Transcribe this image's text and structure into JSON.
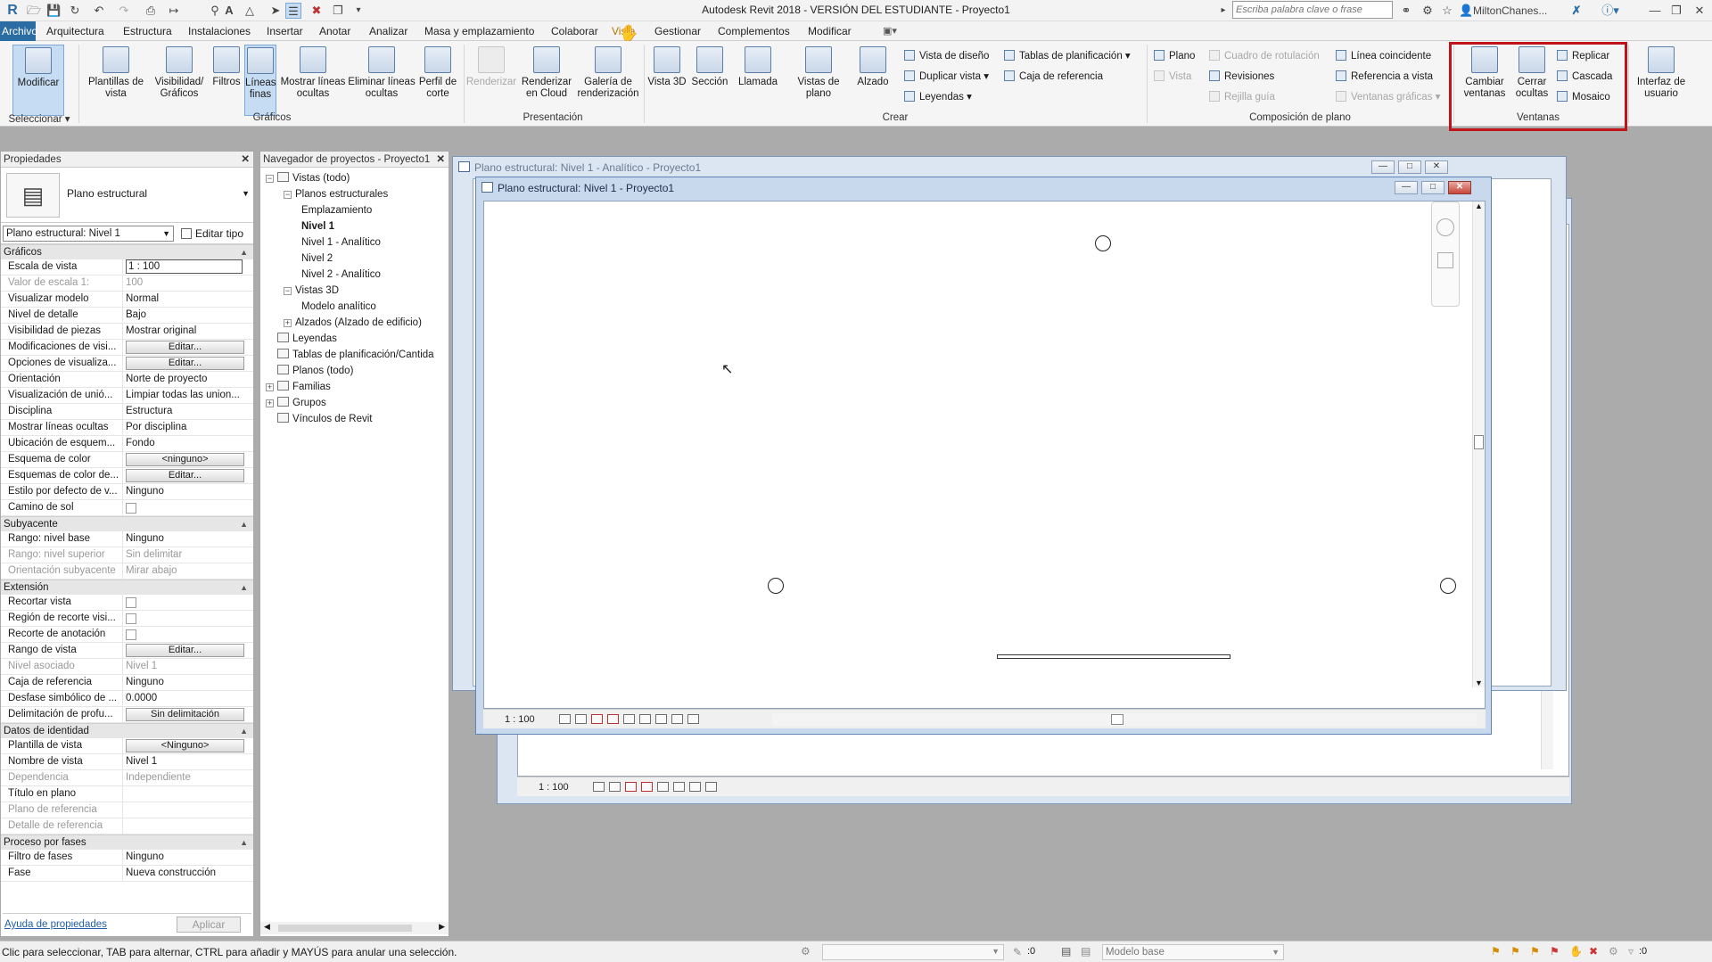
{
  "window": {
    "title": "Autodesk Revit 2018 - VERSIÓN DEL ESTUDIANTE -    Proyecto1",
    "search_placeholder": "Escriba palabra clave o frase",
    "user": "MiltonChanes..."
  },
  "menu": {
    "tabs": [
      "Archivo",
      "Arquitectura",
      "Estructura",
      "Instalaciones",
      "Insertar",
      "Anotar",
      "Analizar",
      "Masa y emplazamiento",
      "Colaborar",
      "Vista",
      "Gestionar",
      "Complementos",
      "Modificar"
    ]
  },
  "ribbon": {
    "select": {
      "modify": "Modificar",
      "select_label": "Seleccionar"
    },
    "graphics": {
      "label": "Gráficos",
      "items": [
        "Plantillas de vista",
        "Visibilidad/ Gráficos",
        "Filtros",
        "Líneas finas",
        "Mostrar líneas ocultas",
        "Eliminar líneas ocultas",
        "Perfil de corte"
      ]
    },
    "presentation": {
      "label": "Presentación",
      "items": [
        "Renderizar",
        "Renderizar en Cloud",
        "Galería de renderización"
      ]
    },
    "create": {
      "label": "Crear",
      "items": [
        "Vista 3D",
        "Sección",
        "Llamada",
        "Vistas de plano",
        "Alzado"
      ],
      "small": [
        "Vista de diseño",
        "Duplicar vista",
        "Leyendas",
        "Tablas de planificación",
        "Caja de referencia"
      ]
    },
    "sheet": {
      "label": "Composición de plano",
      "small": [
        "Plano",
        "Vista",
        "Cuadro de rotulación",
        "Revisiones",
        "Rejilla guía",
        "Línea coincidente",
        "Referencia a vista",
        "Ventanas gráficas"
      ]
    },
    "windows": {
      "label": "Ventanas",
      "items": [
        "Cambiar ventanas",
        "Cerrar ocultas"
      ],
      "small": [
        "Replicar",
        "Cascada",
        "Mosaico"
      ]
    },
    "ui": {
      "label": "Interfaz de usuario"
    }
  },
  "properties": {
    "title": "Propiedades",
    "type_name": "Plano estructural",
    "selector": "Plano estructural: Nivel 1",
    "edit_type": "Editar tipo",
    "sections": [
      {
        "name": "Gráficos",
        "rows": [
          {
            "k": "Escala de vista",
            "v": "1 : 100",
            "t": "input"
          },
          {
            "k": "Valor de escala    1:",
            "v": "100",
            "t": "dis"
          },
          {
            "k": "Visualizar modelo",
            "v": "Normal"
          },
          {
            "k": "Nivel de detalle",
            "v": "Bajo"
          },
          {
            "k": "Visibilidad de piezas",
            "v": "Mostrar original"
          },
          {
            "k": "Modificaciones de visi...",
            "v": "Editar...",
            "t": "btn"
          },
          {
            "k": "Opciones de visualiza...",
            "v": "Editar...",
            "t": "btn"
          },
          {
            "k": "Orientación",
            "v": "Norte de proyecto"
          },
          {
            "k": "Visualización de unió...",
            "v": "Limpiar todas las union..."
          },
          {
            "k": "Disciplina",
            "v": "Estructura"
          },
          {
            "k": "Mostrar líneas ocultas",
            "v": "Por disciplina"
          },
          {
            "k": "Ubicación de esquem...",
            "v": "Fondo"
          },
          {
            "k": "Esquema de color",
            "v": "<ninguno>",
            "t": "btn"
          },
          {
            "k": "Esquemas de color de...",
            "v": "Editar...",
            "t": "btn"
          },
          {
            "k": "Estilo por defecto de v...",
            "v": "Ninguno"
          },
          {
            "k": "Camino de sol",
            "v": "",
            "t": "chk"
          }
        ]
      },
      {
        "name": "Subyacente",
        "rows": [
          {
            "k": "Rango: nivel base",
            "v": "Ninguno"
          },
          {
            "k": "Rango: nivel superior",
            "v": "Sin delimitar",
            "t": "dis"
          },
          {
            "k": "Orientación subyacente",
            "v": "Mirar abajo",
            "t": "dis"
          }
        ]
      },
      {
        "name": "Extensión",
        "rows": [
          {
            "k": "Recortar vista",
            "v": "",
            "t": "chk"
          },
          {
            "k": "Región de recorte visi...",
            "v": "",
            "t": "chk"
          },
          {
            "k": "Recorte de anotación",
            "v": "",
            "t": "chk"
          },
          {
            "k": "Rango de vista",
            "v": "Editar...",
            "t": "btn"
          },
          {
            "k": "Nivel asociado",
            "v": "Nivel 1",
            "t": "dis"
          },
          {
            "k": "Caja de referencia",
            "v": "Ninguno"
          },
          {
            "k": "Desfase simbólico de ...",
            "v": "0.0000"
          },
          {
            "k": "Delimitación de profu...",
            "v": "Sin delimitación",
            "t": "btn"
          }
        ]
      },
      {
        "name": "Datos de identidad",
        "rows": [
          {
            "k": "Plantilla de vista",
            "v": "<Ninguno>",
            "t": "btn"
          },
          {
            "k": "Nombre de vista",
            "v": "Nivel 1"
          },
          {
            "k": "Dependencia",
            "v": "Independiente",
            "t": "dis"
          },
          {
            "k": "Título en plano",
            "v": ""
          },
          {
            "k": "Plano de referencia",
            "v": "",
            "t": "dis"
          },
          {
            "k": "Detalle de referencia",
            "v": "",
            "t": "dis"
          }
        ]
      },
      {
        "name": "Proceso por fases",
        "rows": [
          {
            "k": "Filtro de fases",
            "v": "Ninguno"
          },
          {
            "k": "Fase",
            "v": "Nueva construcción"
          }
        ]
      }
    ],
    "help": "Ayuda de propiedades",
    "apply": "Aplicar"
  },
  "browser": {
    "title": "Navegador de proyectos - Proyecto1",
    "items": [
      {
        "l": "Vistas (todo)",
        "d": 0,
        "tg": "-",
        "ic": true
      },
      {
        "l": "Planos estructurales",
        "d": 1,
        "tg": "-"
      },
      {
        "l": "Emplazamiento",
        "d": 2
      },
      {
        "l": "Nivel 1",
        "d": 2,
        "b": true
      },
      {
        "l": "Nivel 1 - Analítico",
        "d": 2
      },
      {
        "l": "Nivel 2",
        "d": 2
      },
      {
        "l": "Nivel 2 - Analítico",
        "d": 2
      },
      {
        "l": "Vistas 3D",
        "d": 1,
        "tg": "-"
      },
      {
        "l": "Modelo analítico",
        "d": 2
      },
      {
        "l": "Alzados (Alzado de edificio)",
        "d": 1,
        "tg": "+"
      },
      {
        "l": "Leyendas",
        "d": 0,
        "ic": true
      },
      {
        "l": "Tablas de planificación/Cantida",
        "d": 0,
        "ic": true
      },
      {
        "l": "Planos (todo)",
        "d": 0,
        "ic": true
      },
      {
        "l": "Familias",
        "d": 0,
        "tg": "+",
        "ic": true
      },
      {
        "l": "Grupos",
        "d": 0,
        "tg": "+",
        "ic": true
      },
      {
        "l": "Vínculos de Revit",
        "d": 0,
        "ic": true
      }
    ]
  },
  "views": {
    "back_title": "Plano estructural: Nivel 1 - Analítico - Proyecto1",
    "front_title": "Plano estructural: Nivel 1 - Proyecto1",
    "scale": "1 : 100"
  },
  "status": {
    "hint": "Clic para seleccionar, TAB para alternar, CTRL para añadir y MAYÚS para anular una selección.",
    "coord": ":0",
    "model": "Modelo base",
    "filter": ":0"
  },
  "colors": {
    "accent": "#2b6ca3",
    "highlight": "#c0141b"
  }
}
